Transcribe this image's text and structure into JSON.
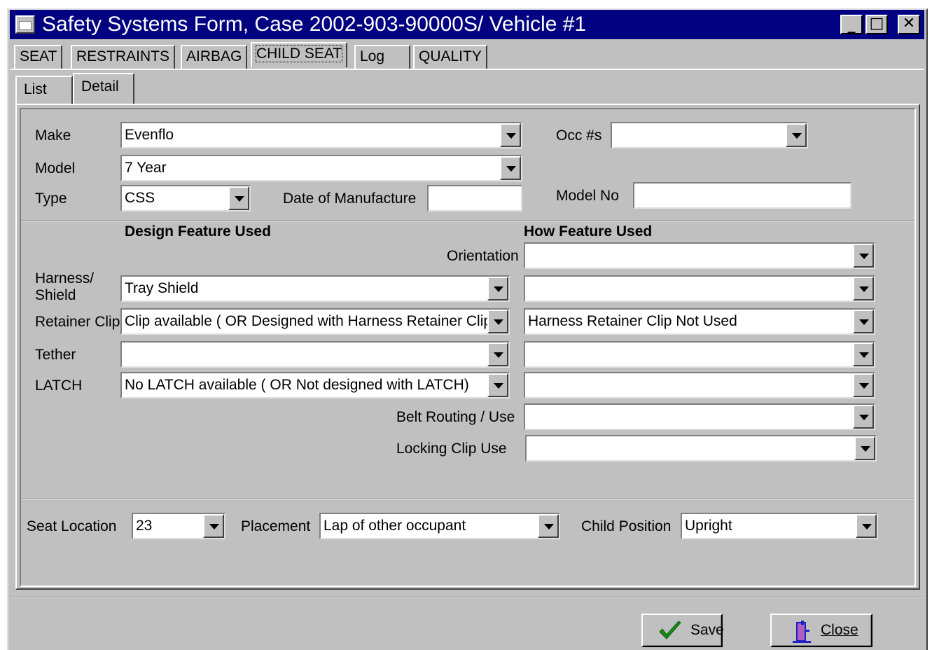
{
  "window": {
    "title": "Safety Systems Form, Case 2002-903-90000S/ Vehicle #1",
    "controls": {
      "minimize": "_",
      "maximize": "□",
      "close": "✕"
    }
  },
  "tabs": [
    "SEAT",
    "RESTRAINTS",
    "AIRBAG",
    "CHILD SEAT",
    "Log",
    "QUALITY"
  ],
  "subtabs": [
    "List",
    "Detail"
  ],
  "top": {
    "make_label": "Make",
    "make_value": "Evenflo",
    "model_label": "Model",
    "model_value": "7 Year",
    "type_label": "Type",
    "type_value": "CSS",
    "date_label": "Date of Manufacture",
    "date_value": "",
    "occ_label": "Occ #s",
    "occ_value": "",
    "modelno_label": "Model No",
    "modelno_value": ""
  },
  "features": {
    "design_header": "Design Feature Used",
    "how_header": "How Feature Used",
    "orientation_label": "Orientation",
    "orientation_value": "",
    "harness_label_1": "Harness/",
    "harness_label_2": "Shield",
    "harness_design": "Tray Shield",
    "harness_how": "",
    "retainer_label": "Retainer Clip",
    "retainer_design": "Clip available ( OR Designed with Harness Retainer Clip",
    "retainer_how": "Harness Retainer Clip Not Used",
    "tether_label": "Tether",
    "tether_design": "",
    "tether_how": "",
    "latch_label": "LATCH",
    "latch_design": "No LATCH available ( OR Not designed with LATCH)",
    "latch_how": "",
    "belt_label": "Belt Routing / Use",
    "belt_value": "",
    "locking_label": "Locking Clip Use",
    "locking_value": ""
  },
  "bottom": {
    "seat_label": "Seat Location",
    "seat_value": "23",
    "placement_label": "Placement",
    "placement_value": "Lap of other occupant",
    "position_label": "Child Position",
    "position_value": "Upright"
  },
  "buttons": {
    "save": "Save",
    "close": "Close"
  },
  "colors": {
    "titlebar": "#000080",
    "face": "#c0c0c0",
    "save_check": "#1a8a1a",
    "close_icon": "#2020c0"
  }
}
